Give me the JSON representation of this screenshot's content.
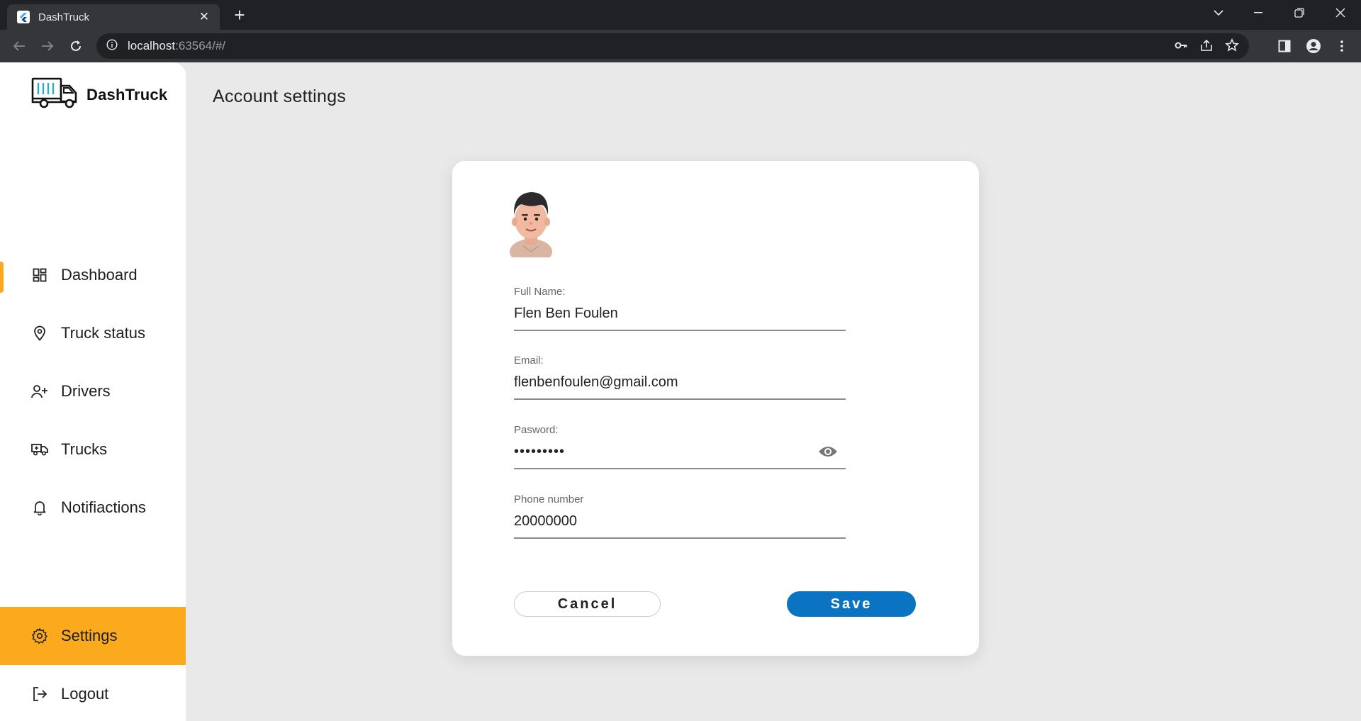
{
  "browser": {
    "tab_title": "DashTruck",
    "new_tab": "+",
    "url_host": "localhost",
    "url_rest": ":63564/#/"
  },
  "app": {
    "brand": "DashTruck",
    "accent_color": "#fbaa1e",
    "primary_color": "#0a73c2"
  },
  "sidebar": {
    "items": [
      {
        "label": "Dashboard",
        "icon": "dashboard-icon"
      },
      {
        "label": "Truck status",
        "icon": "location-pin-icon"
      },
      {
        "label": "Drivers",
        "icon": "add-user-icon"
      },
      {
        "label": "Trucks",
        "icon": "truck-icon"
      },
      {
        "label": "Notifiactions",
        "icon": "bell-icon"
      },
      {
        "label": "Settings",
        "icon": "gear-icon"
      },
      {
        "label": "Logout",
        "icon": "logout-icon"
      }
    ]
  },
  "main": {
    "title": "Account settings"
  },
  "form": {
    "full_name": {
      "label": "Full Name:",
      "value": "Flen Ben Foulen"
    },
    "email": {
      "label": "Email:",
      "value": "flenbenfoulen@gmail.com"
    },
    "password": {
      "label": "Pasword:",
      "value": "•••••••••"
    },
    "phone": {
      "label": "Phone number",
      "value": "20000000"
    },
    "cancel_label": "Cancel",
    "save_label": "Save"
  }
}
